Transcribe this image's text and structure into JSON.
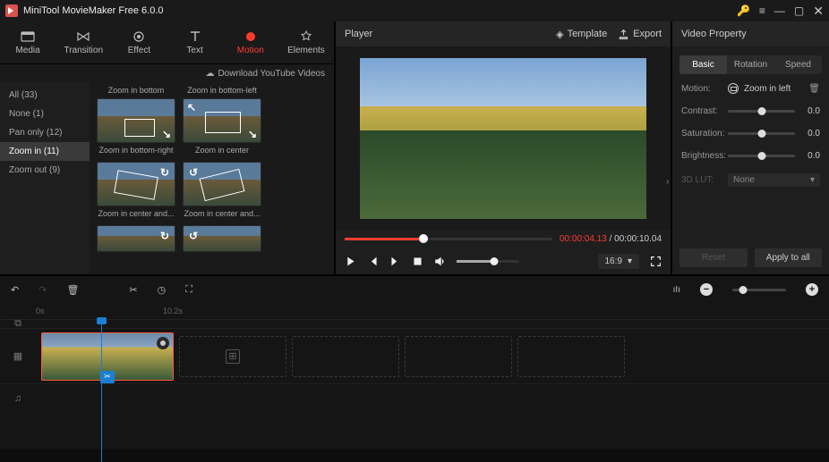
{
  "app": {
    "title": "MiniTool MovieMaker Free 6.0.0"
  },
  "toolbar": {
    "items": [
      {
        "id": "media",
        "label": "Media"
      },
      {
        "id": "transition",
        "label": "Transition"
      },
      {
        "id": "effect",
        "label": "Effect"
      },
      {
        "id": "text",
        "label": "Text"
      },
      {
        "id": "motion",
        "label": "Motion"
      },
      {
        "id": "elements",
        "label": "Elements"
      }
    ],
    "active": "motion",
    "download_label": "Download YouTube Videos"
  },
  "categories": {
    "items": [
      {
        "label": "All (33)"
      },
      {
        "label": "None (1)"
      },
      {
        "label": "Pan only (12)"
      },
      {
        "label": "Zoom in (11)"
      },
      {
        "label": "Zoom out (9)"
      }
    ],
    "active_index": 3
  },
  "thumbnails": [
    {
      "top": "Zoom in bottom",
      "bottom": "Zoom in bottom-right"
    },
    {
      "top": "Zoom in bottom-left",
      "bottom": "Zoom in center"
    },
    {
      "top": "",
      "bottom": "Zoom in center and..."
    },
    {
      "top": "",
      "bottom": "Zoom in center and..."
    },
    {
      "top": "",
      "bottom": ""
    },
    {
      "top": "",
      "bottom": ""
    }
  ],
  "player": {
    "title": "Player",
    "template_label": "Template",
    "export_label": "Export",
    "current_time": "00:00:04.13",
    "total_time": "00:00:10.04",
    "aspect": "16:9"
  },
  "props": {
    "title": "Video Property",
    "tabs": [
      "Basic",
      "Rotation",
      "Speed"
    ],
    "active_tab": 0,
    "motion_label": "Motion:",
    "motion_value": "Zoom in left",
    "rows": [
      {
        "label": "Contrast:",
        "value": "0.0"
      },
      {
        "label": "Saturation:",
        "value": "0.0"
      },
      {
        "label": "Brightness:",
        "value": "0.0"
      }
    ],
    "lut_label": "3D LUT:",
    "lut_value": "None",
    "reset_label": "Reset",
    "apply_label": "Apply to all"
  },
  "timeline": {
    "ticks": [
      "0s",
      "10.2s"
    ]
  }
}
